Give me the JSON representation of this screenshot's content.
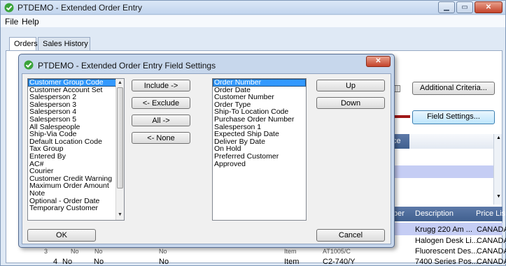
{
  "window": {
    "title": "PTDEMO - Extended Order Entry"
  },
  "menu": {
    "file": "File",
    "help": "Help"
  },
  "tabs": [
    "Orders",
    "Sales History"
  ],
  "buttons": {
    "additional_criteria": "Additional Criteria...",
    "field_settings": "Field Settings..."
  },
  "grid_right": {
    "header_partial": "ce",
    "headers": {
      "number": "ber",
      "description": "Description",
      "price_list": "Price Lis"
    },
    "rows": [
      {
        "description": "Krugg 220 Am ...",
        "price_list": "CANADA"
      },
      {
        "description": "Halogen Desk Li...",
        "price_list": "CANADA"
      },
      {
        "description": "Fluorescent Des...",
        "price_list": "CANADA"
      },
      {
        "description": "7400 Series Pos...",
        "price_list": "CANADA"
      }
    ]
  },
  "grid_bottom": {
    "partial_row": {
      "line": "3",
      "c1": "No",
      "c2": "No",
      "c3": "No",
      "type": "Item",
      "item": "AT1005/C"
    },
    "row": {
      "line": "4",
      "c1": "No",
      "c2": "No",
      "c3": "No",
      "type": "Item",
      "item": "C2-740/Y"
    }
  },
  "dialog": {
    "title": "PTDEMO - Extended Order Entry Field Settings",
    "available_fields": [
      "Customer Group Code",
      "Customer Account Set",
      "Salesperson 2",
      "Salesperson 3",
      "Salesperson 4",
      "Salesperson 5",
      "All Salespeople",
      "Ship-Via Code",
      "Default Location Code",
      "Tax Group",
      "Entered By",
      "AC#",
      "Courier",
      "Customer Credit Warning",
      "Maximum Order Amount",
      "Note",
      "Optional - Order Date",
      "Temporary Customer"
    ],
    "selected_fields": [
      "Order Number",
      "Order Date",
      "Customer Number",
      "Order Type",
      "Ship-To Location Code",
      "Purchase Order Number",
      "Salesperson 1",
      "Expected Ship Date",
      "Deliver By Date",
      "On Hold",
      "Preferred Customer",
      "Approved"
    ],
    "buttons": {
      "include": "Include ->",
      "exclude": "<- Exclude",
      "all": "All ->",
      "none": "<- None",
      "up": "Up",
      "down": "Down",
      "ok": "OK",
      "cancel": "Cancel"
    }
  },
  "colors": {
    "selection": "#3399ff",
    "grid_header": "#4a6898",
    "highlight_row": "#c5cdf4",
    "annotation_arrow": "#a01818"
  }
}
